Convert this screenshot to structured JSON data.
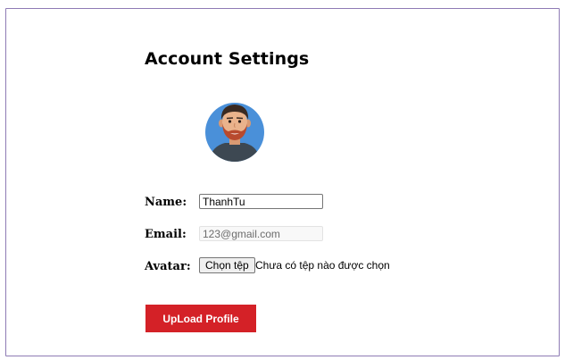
{
  "page": {
    "title": "Account Settings"
  },
  "avatar": {
    "icon": "bearded-man-avatar-icon"
  },
  "form": {
    "name_label": "Name:",
    "name_value": "ThanhTu",
    "email_label": "Email:",
    "email_value": "123@gmail.com",
    "avatar_label": "Avatar:",
    "file_button_label": "Chọn tệp",
    "file_status": "Chưa có tệp nào được chọn"
  },
  "actions": {
    "upload_label": "UpLoad Profile"
  },
  "colors": {
    "accent": "#d42127",
    "frame_border": "#8e7bb4",
    "avatar_bg": "#4a90d9"
  }
}
